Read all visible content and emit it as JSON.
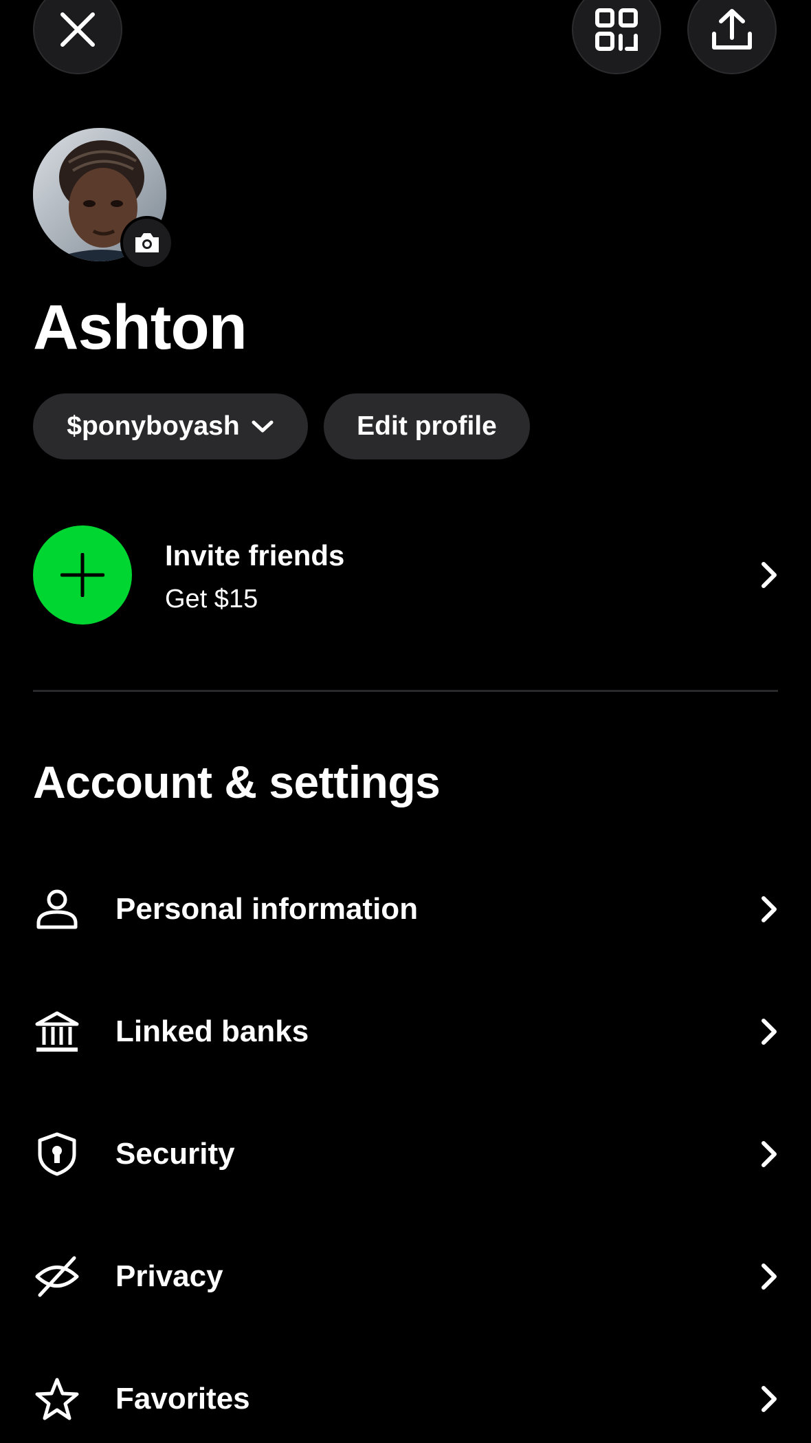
{
  "header": {
    "close_icon": "close-icon",
    "qr_icon": "qr-code-icon",
    "share_icon": "share-upload-icon"
  },
  "profile": {
    "avatar_icon": "avatar",
    "camera_icon": "camera-icon",
    "name": "Ashton",
    "cashtag": "$ponyboyash",
    "cashtag_icon": "chevron-down-icon",
    "edit_label": "Edit profile"
  },
  "invite": {
    "icon": "plus-icon",
    "title": "Invite friends",
    "subtitle": "Get $15",
    "accent_color": "#00d632"
  },
  "section": {
    "title": "Account & settings"
  },
  "settings": {
    "items": [
      {
        "label": "Personal information",
        "icon": "person-icon"
      },
      {
        "label": "Linked banks",
        "icon": "bank-icon"
      },
      {
        "label": "Security",
        "icon": "shield-lock-icon"
      },
      {
        "label": "Privacy",
        "icon": "eye-slash-icon"
      },
      {
        "label": "Favorites",
        "icon": "star-icon"
      }
    ]
  },
  "colors": {
    "background": "#000000",
    "surface": "#2a2a2c",
    "text": "#ffffff",
    "accent": "#00d632"
  }
}
